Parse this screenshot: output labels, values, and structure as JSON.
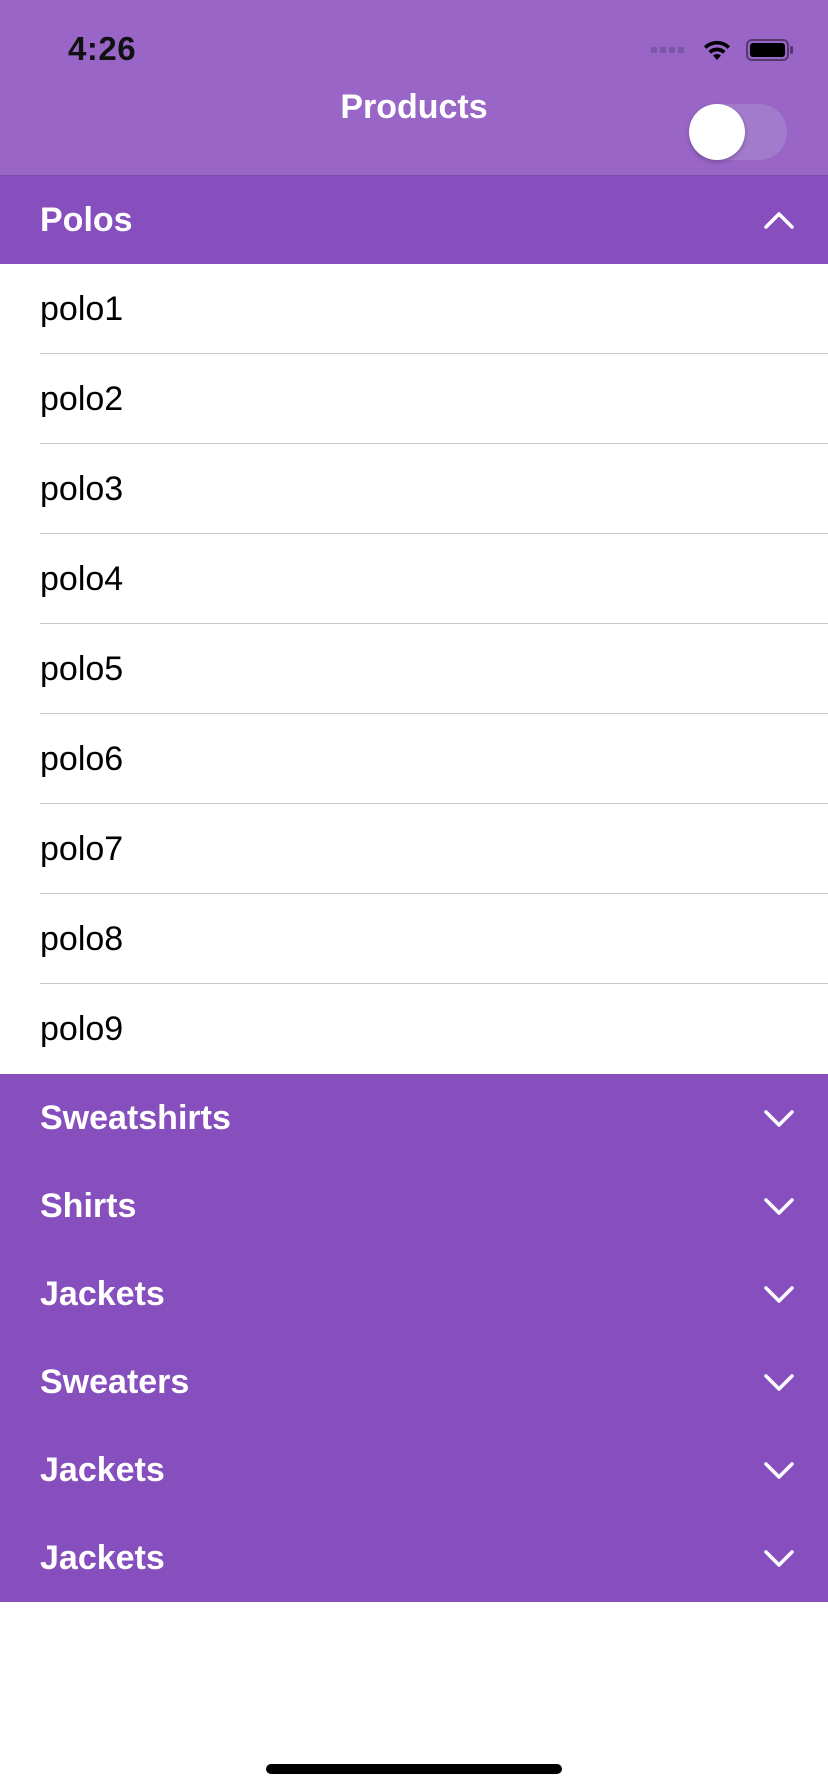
{
  "status_bar": {
    "time": "4:26"
  },
  "nav": {
    "title": "Products",
    "toggle_on": false
  },
  "sections": [
    {
      "label": "Polos",
      "expanded": true,
      "items": [
        "polo1",
        "polo2",
        "polo3",
        "polo4",
        "polo5",
        "polo6",
        "polo7",
        "polo8",
        "polo9"
      ]
    },
    {
      "label": "Sweatshirts",
      "expanded": false,
      "items": []
    },
    {
      "label": "Shirts",
      "expanded": false,
      "items": []
    },
    {
      "label": "Jackets",
      "expanded": false,
      "items": []
    },
    {
      "label": "Sweaters",
      "expanded": false,
      "items": []
    },
    {
      "label": "Jackets",
      "expanded": false,
      "items": []
    },
    {
      "label": "Jackets",
      "expanded": false,
      "items": []
    }
  ],
  "colors": {
    "header_bg": "#9966c8",
    "section_bg": "#874fbe",
    "text_on_accent": "#ffffff"
  },
  "icons": {
    "expanded": "chevron-up-icon",
    "collapsed": "chevron-down-icon"
  }
}
